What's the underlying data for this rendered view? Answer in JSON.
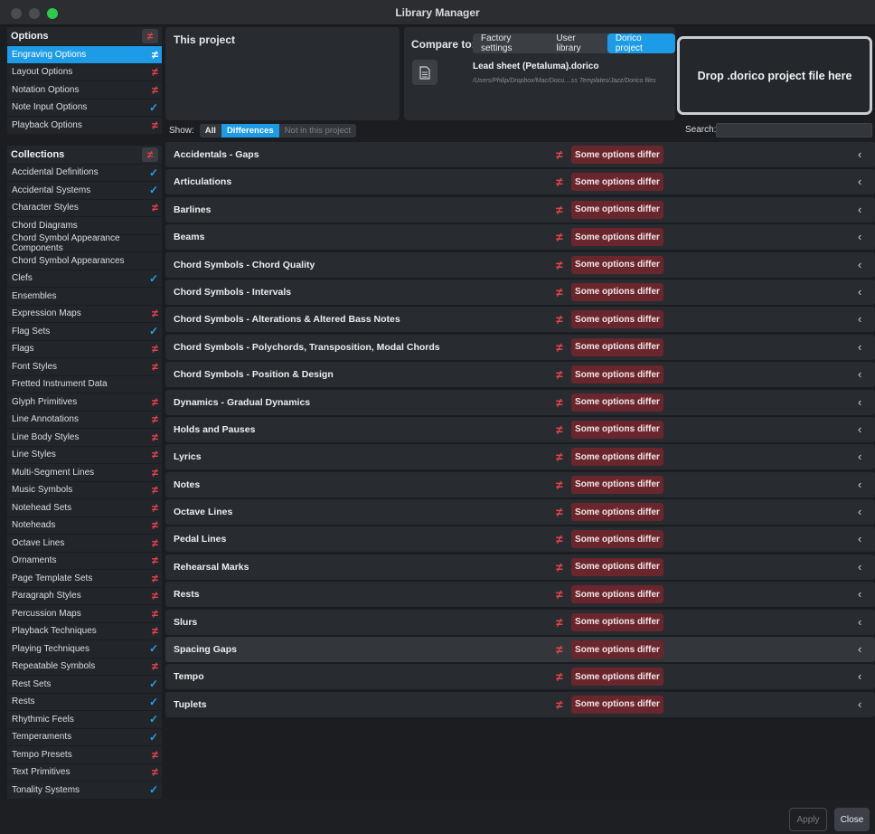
{
  "window": {
    "title": "Library Manager"
  },
  "sidebar": {
    "options_title": "Options",
    "options": [
      {
        "label": "Engraving Options",
        "status": "differs",
        "selected": true
      },
      {
        "label": "Layout Options",
        "status": "differs"
      },
      {
        "label": "Notation Options",
        "status": "differs"
      },
      {
        "label": "Note Input Options",
        "status": "same"
      },
      {
        "label": "Playback Options",
        "status": "differs"
      }
    ],
    "collections_title": "Collections",
    "collections": [
      {
        "label": "Accidental Definitions",
        "status": "same"
      },
      {
        "label": "Accidental Systems",
        "status": "same"
      },
      {
        "label": "Character Styles",
        "status": "differs"
      },
      {
        "label": "Chord Diagrams",
        "status": "none"
      },
      {
        "label": "Chord Symbol Appearance Components",
        "status": "none"
      },
      {
        "label": "Chord Symbol Appearances",
        "status": "none"
      },
      {
        "label": "Clefs",
        "status": "same"
      },
      {
        "label": "Ensembles",
        "status": "none"
      },
      {
        "label": "Expression Maps",
        "status": "differs"
      },
      {
        "label": "Flag Sets",
        "status": "same"
      },
      {
        "label": "Flags",
        "status": "differs"
      },
      {
        "label": "Font Styles",
        "status": "differs"
      },
      {
        "label": "Fretted Instrument Data",
        "status": "none"
      },
      {
        "label": "Glyph Primitives",
        "status": "differs"
      },
      {
        "label": "Line Annotations",
        "status": "differs"
      },
      {
        "label": "Line Body Styles",
        "status": "differs"
      },
      {
        "label": "Line Styles",
        "status": "differs"
      },
      {
        "label": "Multi-Segment Lines",
        "status": "differs"
      },
      {
        "label": "Music Symbols",
        "status": "differs"
      },
      {
        "label": "Notehead Sets",
        "status": "differs"
      },
      {
        "label": "Noteheads",
        "status": "differs"
      },
      {
        "label": "Octave Lines",
        "status": "differs"
      },
      {
        "label": "Ornaments",
        "status": "differs"
      },
      {
        "label": "Page Template Sets",
        "status": "differs"
      },
      {
        "label": "Paragraph Styles",
        "status": "differs"
      },
      {
        "label": "Percussion Maps",
        "status": "differs"
      },
      {
        "label": "Playback Techniques",
        "status": "differs"
      },
      {
        "label": "Playing Techniques",
        "status": "same"
      },
      {
        "label": "Repeatable Symbols",
        "status": "differs"
      },
      {
        "label": "Rest Sets",
        "status": "same"
      },
      {
        "label": "Rests",
        "status": "same"
      },
      {
        "label": "Rhythmic Feels",
        "status": "same"
      },
      {
        "label": "Temperaments",
        "status": "same"
      },
      {
        "label": "Tempo Presets",
        "status": "differs"
      },
      {
        "label": "Text Primitives",
        "status": "differs"
      },
      {
        "label": "Tonality Systems",
        "status": "same"
      }
    ]
  },
  "this_project": {
    "title": "This project"
  },
  "compare": {
    "label": "Compare to:",
    "tabs": [
      "Factory settings",
      "User library",
      "Dorico project"
    ],
    "active_tab": 2,
    "file_name": "Lead sheet (Petaluma).dorico",
    "file_path": "/Users/Philip/Dropbox/Mac/Docu....ss Templates/Jazz/Dorico files",
    "drop_text": "Drop .dorico project file here"
  },
  "show": {
    "label": "Show:",
    "filters": [
      "All",
      "Differences",
      "Not in this project"
    ],
    "active_filter": 1,
    "search_label": "Search:",
    "search_value": ""
  },
  "categories": [
    {
      "name": "Accidentals - Gaps",
      "badge": "Some options differ"
    },
    {
      "name": "Articulations",
      "badge": "Some options differ"
    },
    {
      "name": "Barlines",
      "badge": "Some options differ"
    },
    {
      "name": "Beams",
      "badge": "Some options differ"
    },
    {
      "name": "Chord Symbols - Chord Quality",
      "badge": "Some options differ"
    },
    {
      "name": "Chord Symbols - Intervals",
      "badge": "Some options differ"
    },
    {
      "name": "Chord Symbols - Alterations & Altered Bass Notes",
      "badge": "Some options differ"
    },
    {
      "name": "Chord Symbols - Polychords, Transposition, Modal Chords",
      "badge": "Some options differ"
    },
    {
      "name": "Chord Symbols - Position & Design",
      "badge": "Some options differ"
    },
    {
      "name": "Dynamics - Gradual Dynamics",
      "badge": "Some options differ"
    },
    {
      "name": "Holds and Pauses",
      "badge": "Some options differ"
    },
    {
      "name": "Lyrics",
      "badge": "Some options differ"
    },
    {
      "name": "Notes",
      "badge": "Some options differ"
    },
    {
      "name": "Octave Lines",
      "badge": "Some options differ"
    },
    {
      "name": "Pedal Lines",
      "badge": "Some options differ"
    },
    {
      "name": "Rehearsal Marks",
      "badge": "Some options differ"
    },
    {
      "name": "Rests",
      "badge": "Some options differ"
    },
    {
      "name": "Slurs",
      "badge": "Some options differ"
    },
    {
      "name": "Spacing Gaps",
      "badge": "Some options differ",
      "highlighted": true
    },
    {
      "name": "Tempo",
      "badge": "Some options differ"
    },
    {
      "name": "Tuplets",
      "badge": "Some options differ"
    }
  ],
  "buttons": {
    "apply": "Apply",
    "close": "Close"
  },
  "colors": {
    "accent": "#1e9be6",
    "differ": "#e7424a",
    "badge_bg": "#6a262d"
  }
}
